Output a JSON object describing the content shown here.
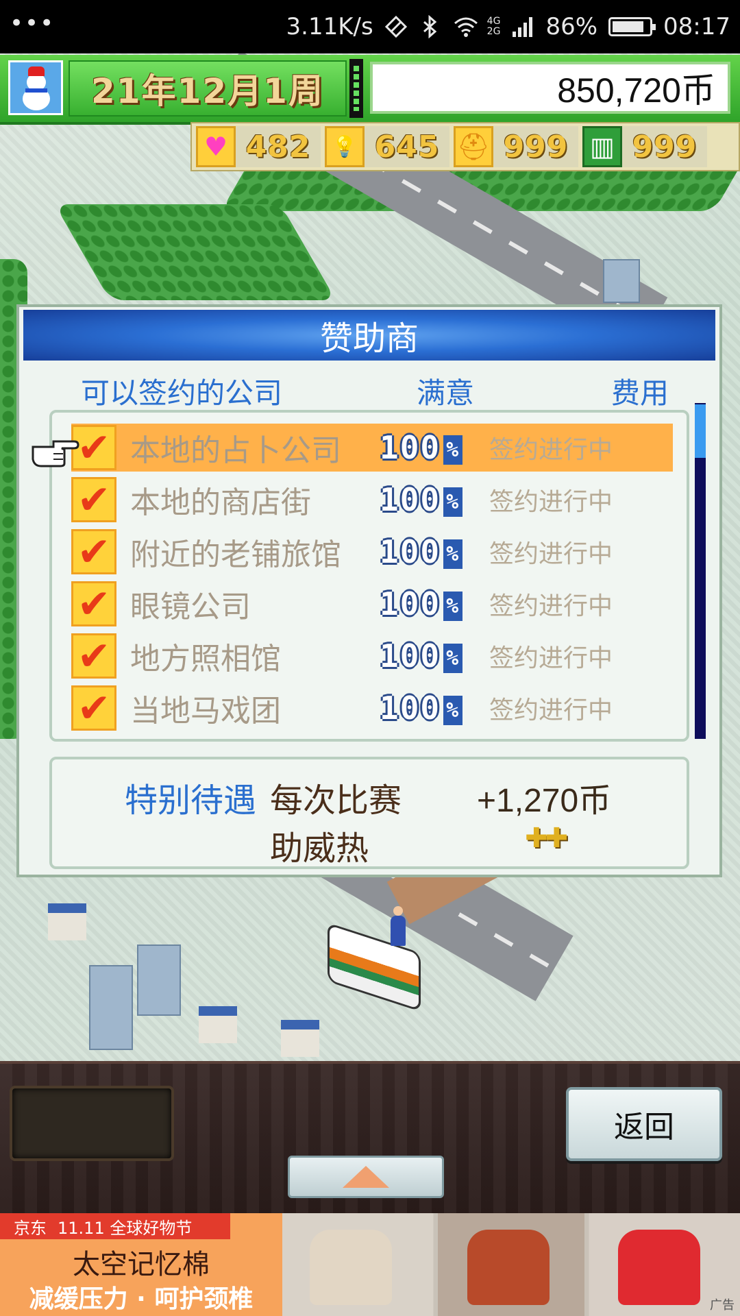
{
  "status_bar": {
    "menu": "•••",
    "speed": "3.11K/s",
    "net_top": "4G",
    "net_bottom": "2G",
    "battery": "86%",
    "battery_level": 0.86,
    "time": "08:17"
  },
  "hud": {
    "date": "21年12月1周",
    "money": "850,720币",
    "stats": [
      {
        "icon": "heart-icon",
        "glyph": "♥",
        "value": "482"
      },
      {
        "icon": "lightbulb-icon",
        "glyph": "💡",
        "value": "645"
      },
      {
        "icon": "cap-icon",
        "glyph": "⛑",
        "value": "999"
      },
      {
        "icon": "field-icon",
        "glyph": "▥",
        "value": "999"
      }
    ]
  },
  "dialog": {
    "title": "赞助商",
    "col_company": "可以签约的公司",
    "col_satisfaction": "满意",
    "col_fee": "费用",
    "rows": [
      {
        "name": "本地的占卜公司",
        "pct": "100",
        "pct_sign": "%",
        "status": "签约进行中",
        "checked": true,
        "selected": true
      },
      {
        "name": "本地的商店街",
        "pct": "100",
        "pct_sign": "%",
        "status": "签约进行中",
        "checked": true,
        "selected": false
      },
      {
        "name": "附近的老铺旅馆",
        "pct": "100",
        "pct_sign": "%",
        "status": "签约进行中",
        "checked": true,
        "selected": false
      },
      {
        "name": "眼镜公司",
        "pct": "100",
        "pct_sign": "%",
        "status": "签约进行中",
        "checked": true,
        "selected": false
      },
      {
        "name": "地方照相馆",
        "pct": "100",
        "pct_sign": "%",
        "status": "签约进行中",
        "checked": true,
        "selected": false
      },
      {
        "name": "当地马戏团",
        "pct": "100",
        "pct_sign": "%",
        "status": "签约进行中",
        "checked": true,
        "selected": false
      }
    ],
    "bonus": {
      "label": "特别待遇",
      "per_match": "每次比赛",
      "amount": "+1,270币",
      "cheer": "助威热",
      "cheer_value": "✚✚"
    }
  },
  "controls": {
    "back_label": "返回",
    "up_icon": "triangle-up-icon"
  },
  "ad": {
    "brand": "京东",
    "promo": "11.11 全球好物节",
    "line1": "太空记忆棉",
    "line2": "减缓压力 · 呵护颈椎",
    "corner": "广告"
  },
  "colors": {
    "accent_blue": "#2a6fcf",
    "selected_row": "#ffb14a",
    "hud_green": "#2fa32a",
    "title_blue": "#2b6fd4"
  }
}
